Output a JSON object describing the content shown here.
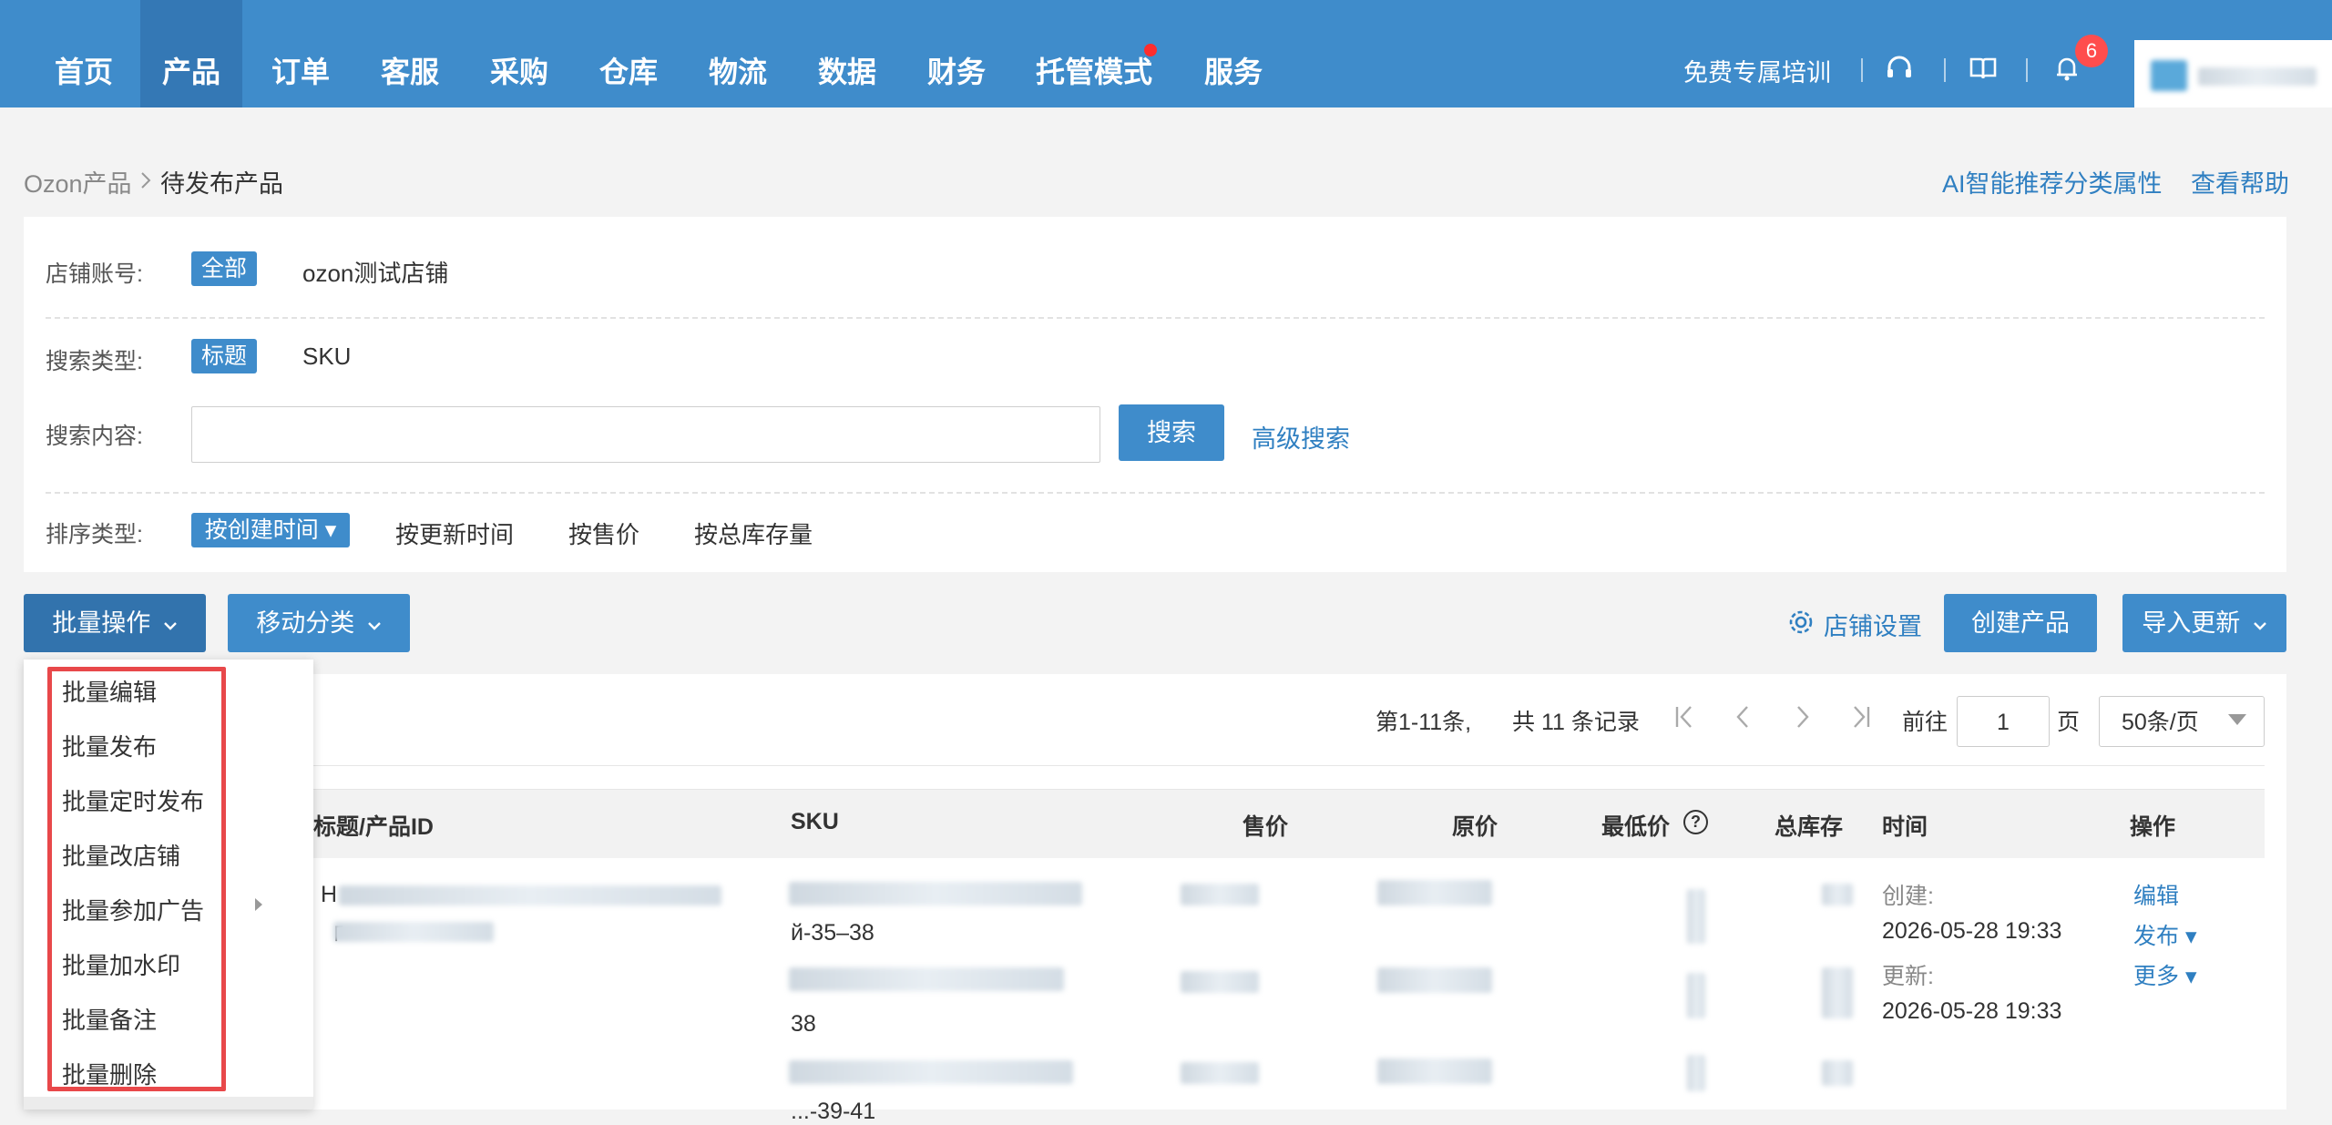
{
  "nav": {
    "items": [
      "首页",
      "产品",
      "订单",
      "客服",
      "采购",
      "仓库",
      "物流",
      "数据",
      "财务",
      "托管模式",
      "服务"
    ],
    "active": "产品",
    "training_label": "免费专属培训",
    "notification_count": "6",
    "colors": {
      "nav_bg": "#3f8ccb",
      "active_bg": "#3478b5",
      "badge": "#ff4d4d"
    }
  },
  "breadcrumb": {
    "root": "Ozon产品",
    "current": "待发布产品"
  },
  "header_links": {
    "ai": "AI智能推荐分类属性",
    "help": "查看帮助"
  },
  "filters": {
    "store": {
      "label": "店铺账号:",
      "all": "全部",
      "option": "ozon测试店铺"
    },
    "search_type": {
      "label": "搜索类型:",
      "selected": "标题",
      "option": "SKU"
    },
    "search_content": {
      "label": "搜索内容:",
      "value": "",
      "search_btn": "搜索",
      "advanced": "高级搜索"
    },
    "sort": {
      "label": "排序类型:",
      "selected": "按创建时间 ▾",
      "options": [
        "按更新时间",
        "按售价",
        "按总库存量"
      ]
    }
  },
  "toolbar": {
    "bulk_ops": "批量操作",
    "move_category": "移动分类",
    "store_settings": "店铺设置",
    "create_product": "创建产品",
    "import_update": "导入更新"
  },
  "bulk_menu": [
    "批量编辑",
    "批量发布",
    "批量定时发布",
    "批量改店铺",
    "批量参加广告",
    "批量加水印",
    "批量备注",
    "批量删除"
  ],
  "pagination": {
    "range": "第1-11条,",
    "total": "共 11 条记录",
    "goto_label": "前往",
    "page": "1",
    "page_unit": "页",
    "page_size": "50条/页"
  },
  "table": {
    "columns": [
      "标题/产品ID",
      "SKU",
      "售价",
      "原价",
      "最低价",
      "总库存",
      "时间",
      "操作"
    ],
    "row": {
      "title_prefix": "H",
      "title_line2_prefix": "「",
      "sku_fragment_1": "й-35–38",
      "sku_fragment_2": "38",
      "sku_fragment_3": "...-39-41",
      "created_label": "创建:",
      "created": "2026-05-28 19:33",
      "updated_label": "更新:",
      "updated": "2026-05-28 19:33",
      "actions": {
        "edit": "编辑",
        "publish": "发布 ▾",
        "more": "更多 ▾"
      }
    }
  }
}
